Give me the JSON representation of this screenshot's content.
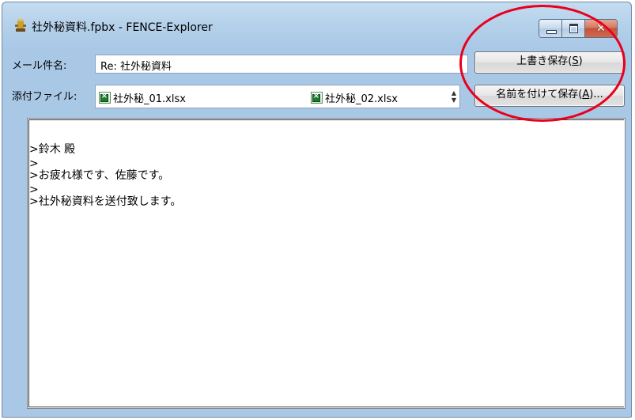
{
  "window": {
    "title": "社外秘資料.fpbx - FENCE-Explorer",
    "icon": "fence-explorer-app-icon",
    "controls": {
      "minimize": "minimize-icon",
      "maximize": "maximize-icon",
      "close": "close-icon"
    }
  },
  "mail": {
    "subject_label": "メール件名:",
    "subject_value": "Re: 社外秘資料",
    "attachments_label": "添付ファイル:",
    "attachments": [
      {
        "name": "社外秘_01.xlsx",
        "icon": "excel-file-icon"
      },
      {
        "name": "社外秘_02.xlsx",
        "icon": "excel-file-icon"
      }
    ]
  },
  "buttons": {
    "overwrite_save": "上書き保存(",
    "overwrite_save_key": "S",
    "overwrite_save_end": ")",
    "save_as": "名前を付けて保存(",
    "save_as_key": "A",
    "save_as_end": ")..."
  },
  "body_text": [
    ">鈴木 殿",
    ">",
    ">お疲れ様です、佐藤です。",
    ">",
    ">社外秘資料を送付致します。"
  ],
  "annotation": {
    "highlight_color": "#e8001c"
  }
}
